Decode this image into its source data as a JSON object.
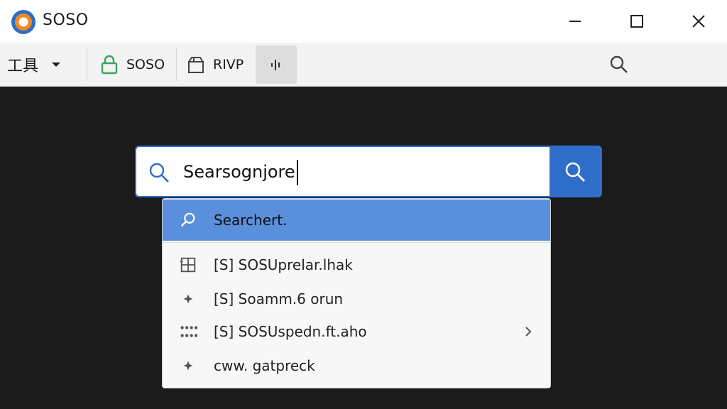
{
  "window": {
    "title": "SOSO"
  },
  "toolbar": {
    "tools_label": "工具",
    "soso_label": "SOSO",
    "rivp_label": "RIVP"
  },
  "search": {
    "value": "Searsognjore"
  },
  "dropdown": {
    "items": [
      {
        "icon": "search-icon",
        "label": "Searchert."
      },
      {
        "icon": "grid-icon",
        "label": "[S] SOSUprelar.lhak"
      },
      {
        "icon": "sparkle-icon",
        "label": "[S] Soamm.6 orun"
      },
      {
        "icon": "dots-grid-icon",
        "label": "[S] SOSUspedn.ft.aho"
      },
      {
        "icon": "sparkle-icon",
        "label": "cww. gatpreck"
      }
    ]
  },
  "colors": {
    "accent": "#2f6ec8",
    "highlight": "#5a8fdc",
    "background": "#1b1b1b",
    "app_icon_orange": "#f08a24",
    "app_icon_blue": "#2f6ec8",
    "lock_green": "#3ba55c"
  }
}
